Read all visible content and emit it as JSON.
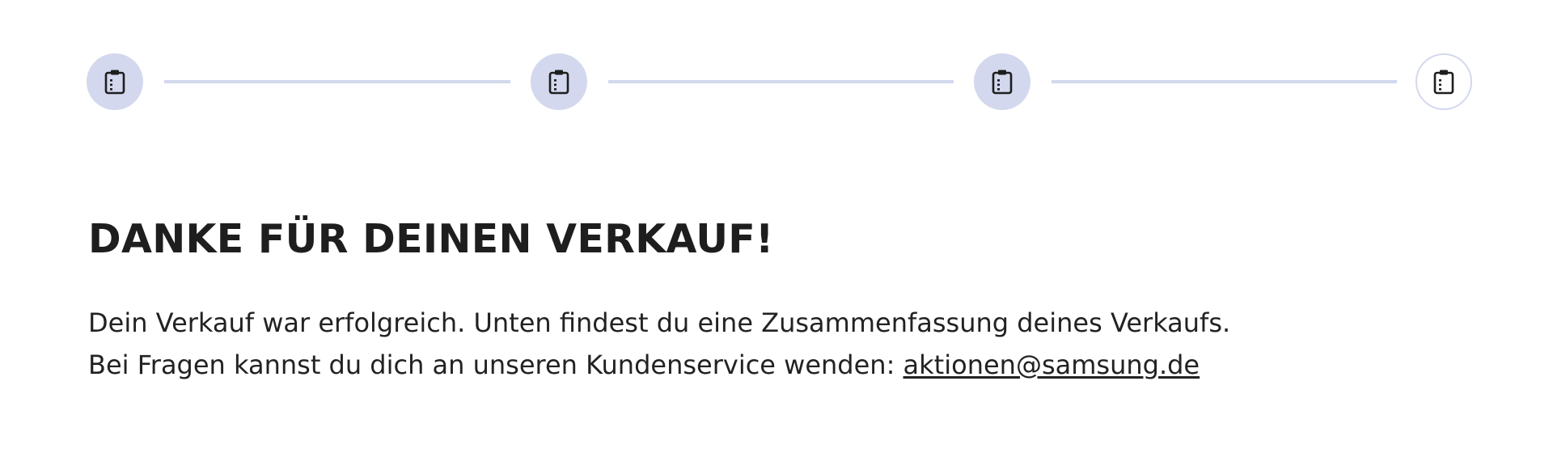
{
  "stepper": {
    "colors": {
      "filled": "#d3d8ee",
      "connector": "#d3d8ee",
      "icon": "#1e1e1e"
    },
    "steps": [
      {
        "icon": "clipboard-icon",
        "state": "completed"
      },
      {
        "icon": "clipboard-icon",
        "state": "completed"
      },
      {
        "icon": "clipboard-icon",
        "state": "completed"
      },
      {
        "icon": "clipboard-icon",
        "state": "pending"
      }
    ]
  },
  "confirmation": {
    "title": "DANKE FÜR DEINEN VERKAUF!",
    "line1": "Dein Verkauf war erfolgreich. Unten findest du eine Zusammenfassung deines Verkaufs.",
    "line2_prefix": "Bei Fragen kannst du dich an unseren Kundenservice wenden: ",
    "email_link": "aktionen@samsung.de"
  }
}
